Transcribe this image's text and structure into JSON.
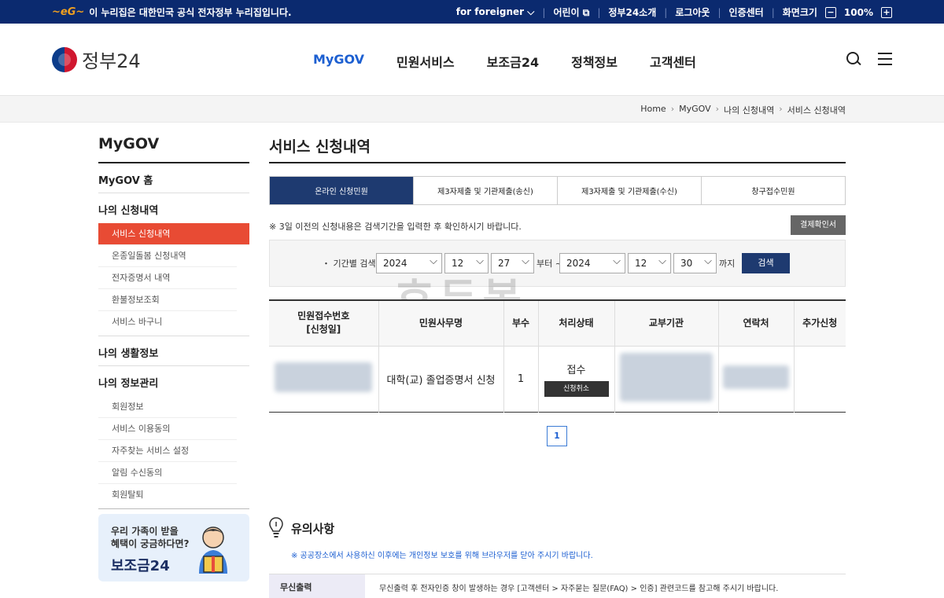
{
  "topbar": {
    "notice": "이 누리집은 대한민국 공식 전자정부 누리집입니다.",
    "foreigner": "for foreigner",
    "kids": "어린이",
    "about": "정부24소개",
    "logout": "로그아웃",
    "cert": "인증센터",
    "zoom_label": "화면크기",
    "zoom_minus": "−",
    "zoom_value": "100%",
    "zoom_plus": "+"
  },
  "header": {
    "logo": "정부24",
    "nav": [
      "MyGOV",
      "민원서비스",
      "보조금24",
      "정책정보",
      "고객센터"
    ]
  },
  "breadcrumb": [
    "Home",
    "MyGOV",
    "나의 신청내역",
    "서비스 신청내역"
  ],
  "sidebar": {
    "title": "MyGOV",
    "home": "MyGOV 홈",
    "apply_title": "나의 신청내역",
    "apply_items": [
      "서비스 신청내역",
      "온종일돌봄 신청내역",
      "전자증명서 내역",
      "환불정보조회",
      "서비스 바구니"
    ],
    "life": "나의 생활정보",
    "info_title": "나의 정보관리",
    "info_items": [
      "회원정보",
      "서비스 이용동의",
      "자주찾는 서비스 설정",
      "알림 수신동의",
      "회원탈퇴"
    ],
    "banner_line1": "우리 가족이 받을",
    "banner_line2": "혜택이 궁금하다면?",
    "banner_title": "보조금24"
  },
  "main": {
    "title": "서비스 신청내역",
    "tabs": [
      "온라인 신청민원",
      "제3자제출 및 기관제출(송신)",
      "제3자제출 및 기관제출(수신)",
      "창구접수민원"
    ],
    "notice": "※ 3일 이전의 신청내용은 검색기간을 입력한 후 확인하시기 바랍니다.",
    "receipt_button": "결제확인서",
    "filter": {
      "label": "・ 기간별 검색",
      "from_year": "2024",
      "from_month": "12",
      "from_day": "27",
      "from_suffix": "부터 ~",
      "to_year": "2024",
      "to_month": "12",
      "to_day": "30",
      "to_suffix": "까지",
      "search": "검색"
    },
    "watermark": "호두봉",
    "table": {
      "headers": [
        "민원접수번호",
        "[신청일]",
        "민원사무명",
        "부수",
        "처리상태",
        "교부기관",
        "연락처",
        "추가신청"
      ],
      "row": {
        "name": "대학(교) 졸업증명서 신청",
        "copies": "1",
        "status": "접수",
        "cancel": "신청취소"
      }
    },
    "page": "1",
    "caution": {
      "title": "유의사항",
      "warn": "※ 공공장소에서 사용하신 이후에는 개인정보 보호를 위해 브라우저를 닫아 주시기 바랍니다.",
      "row_label": "무신출력",
      "row_desc": "무신출력 후 전자인증 창이 발생하는 경우 [고객센터 > 자주묻는 질문(FAQ) > 인증] 관련코드를 참고해 주시기 바랍니다."
    }
  }
}
